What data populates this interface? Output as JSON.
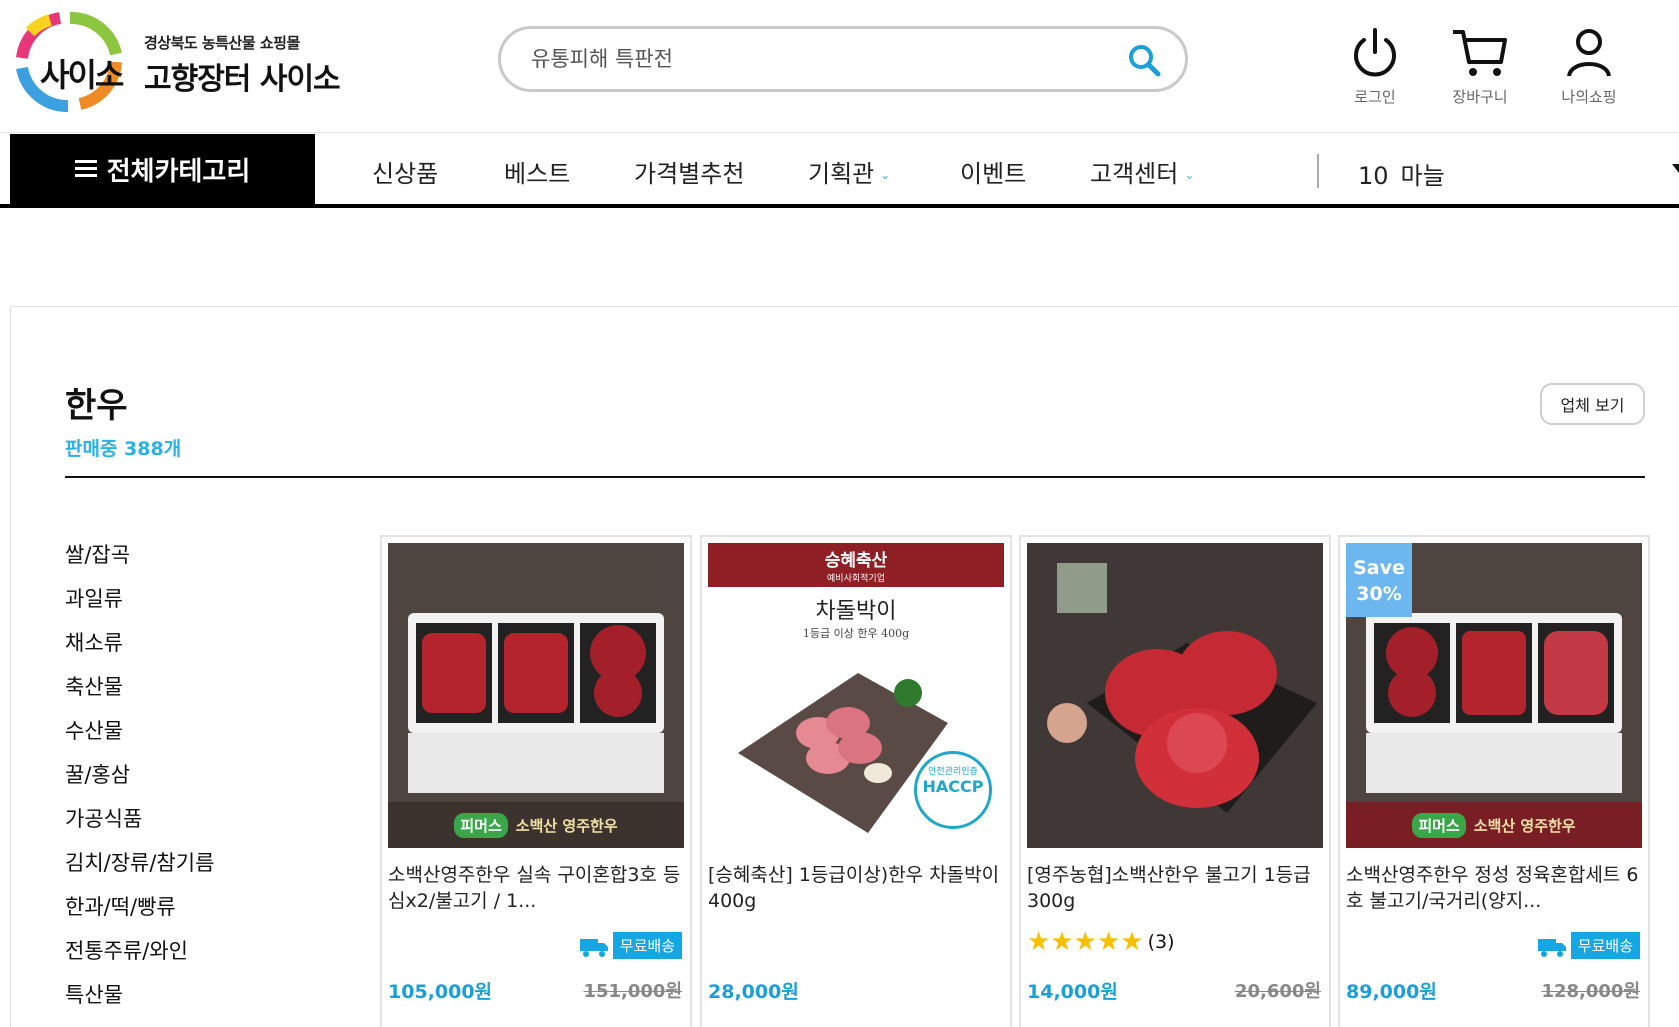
{
  "header": {
    "logo_subtitle": "경상북도 농특산물 쇼핑몰",
    "logo_title": "고향장터 사이소",
    "logo_mark": "사이소",
    "search_placeholder": "유통피해 특판전",
    "icons": [
      {
        "name": "login",
        "label": "로그인",
        "icon": "power-icon"
      },
      {
        "name": "cart",
        "label": "장바구니",
        "icon": "cart-icon"
      },
      {
        "name": "mypage",
        "label": "나의쇼핑",
        "icon": "user-icon"
      }
    ]
  },
  "nav": {
    "all_categories": "전체카테고리",
    "items": [
      {
        "label": "신상품",
        "dropdown": false
      },
      {
        "label": "베스트",
        "dropdown": false
      },
      {
        "label": "가격별추천",
        "dropdown": false
      },
      {
        "label": "기획관",
        "dropdown": true
      },
      {
        "label": "이벤트",
        "dropdown": false
      },
      {
        "label": "고객센터",
        "dropdown": true
      }
    ],
    "ranking": {
      "rank": "10",
      "keyword": "마늘"
    }
  },
  "category": {
    "title": "한우",
    "count_text": "판매중 388개",
    "seller_button": "업체 보기"
  },
  "sidebar": {
    "items": [
      "쌀/잡곡",
      "과일류",
      "채소류",
      "축산물",
      "수산물",
      "꿀/홍삼",
      "가공식품",
      "김치/장류/참기름",
      "한과/떡/빵류",
      "전통주류/와인",
      "특산물"
    ]
  },
  "products": [
    {
      "name": "소백산영주한우 실속 구이혼합3호 등심x2/불고기 / 1...",
      "price": "105,000원",
      "original_price": "151,000원",
      "free_shipping": "무료배송",
      "brand_text": "소백산 영주한우",
      "market_text": "피머스"
    },
    {
      "name": "[승혜축산] 1등급이상)한우 차돌박이 400g",
      "price": "28,000원",
      "original_price": "",
      "banner_brand": "승혜축산",
      "banner_tag": "예비사회적기업",
      "banner_product": "차돌박이",
      "banner_desc": "1등급 이상 한우 400g",
      "haccp_top": "안전관리인증",
      "haccp_main": "HACCP"
    },
    {
      "name": "[영주농협]소백산한우 불고기 1등급 300g",
      "price": "14,000원",
      "original_price": "20,600원",
      "rating_count": "(3)",
      "rating": 5
    },
    {
      "name": "소백산영주한우 정성 정육혼합세트 6호 불고기/국거리(양지...",
      "price": "89,000원",
      "original_price": "128,000원",
      "free_shipping": "무료배송",
      "save_line1": "Save",
      "save_line2": "30%",
      "brand_text": "소백산 영주한우",
      "market_text": "피머스"
    }
  ],
  "colors": {
    "accent_blue": "#1a9fd8",
    "count_blue": "#2ab2e6",
    "nav_black": "#000000",
    "banner_red": "#8e1f24",
    "star_yellow": "#f5c000"
  }
}
